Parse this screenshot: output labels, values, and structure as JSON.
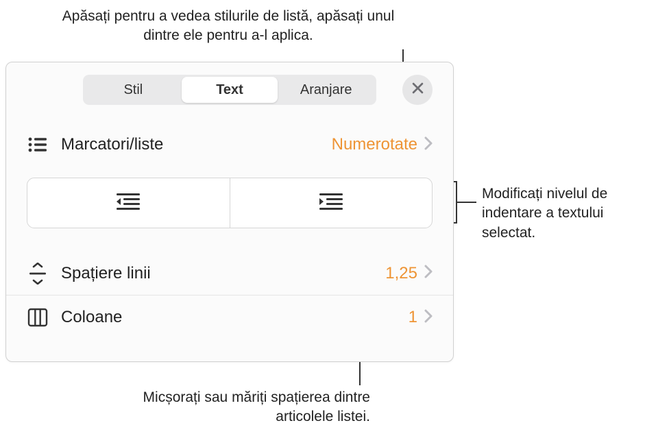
{
  "callouts": {
    "top": "Apăsați pentru a vedea stilurile de listă, apăsați unul dintre ele pentru a-l aplica.",
    "right": "Modificați nivelul de indentare a textului selectat.",
    "bottom": "Micșorați sau măriți spațierea dintre articolele listei."
  },
  "tabs": {
    "stil": "Stil",
    "text": "Text",
    "aranjare": "Aranjare"
  },
  "rows": {
    "bullets_label": "Marcatori/liste",
    "bullets_value": "Numerotate",
    "linespacing_label": "Spațiere linii",
    "linespacing_value": "1,25",
    "columns_label": "Coloane",
    "columns_value": "1"
  },
  "colors": {
    "accent": "#ee9434"
  }
}
